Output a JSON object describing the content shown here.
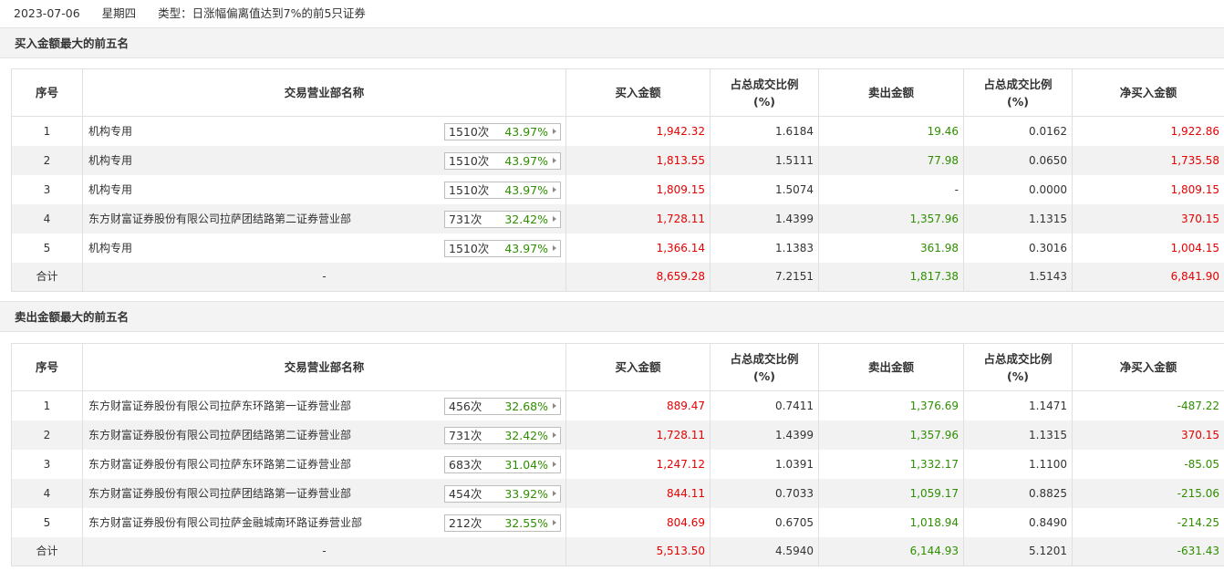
{
  "header": {
    "date": "2023-07-06",
    "weekday": "星期四",
    "type_text": "类型：日涨幅偏离值达到7%的前5只证券"
  },
  "columns": {
    "idx": "序号",
    "name": "交易营业部名称",
    "buy": "买入金额",
    "buy_ratio_line1": "占总成交比例",
    "buy_ratio_line2": "(%)",
    "sell": "卖出金额",
    "sell_ratio_line1": "占总成交比例",
    "sell_ratio_line2": "(%)",
    "net": "净买入金额"
  },
  "buy_section": {
    "title": "买入金额最大的前五名",
    "rows": [
      {
        "idx": "1",
        "name": "机构专用",
        "count": "1510次",
        "pct": "43.97%",
        "buy": "1,942.32",
        "buy_ratio": "1.6184",
        "sell": "19.46",
        "sell_ratio": "0.0162",
        "net": "1,922.86"
      },
      {
        "idx": "2",
        "name": "机构专用",
        "count": "1510次",
        "pct": "43.97%",
        "buy": "1,813.55",
        "buy_ratio": "1.5111",
        "sell": "77.98",
        "sell_ratio": "0.0650",
        "net": "1,735.58"
      },
      {
        "idx": "3",
        "name": "机构专用",
        "count": "1510次",
        "pct": "43.97%",
        "buy": "1,809.15",
        "buy_ratio": "1.5074",
        "sell": "-",
        "sell_ratio": "0.0000",
        "net": "1,809.15"
      },
      {
        "idx": "4",
        "name": "东方财富证券股份有限公司拉萨团结路第二证券营业部",
        "count": "731次",
        "pct": "32.42%",
        "buy": "1,728.11",
        "buy_ratio": "1.4399",
        "sell": "1,357.96",
        "sell_ratio": "1.1315",
        "net": "370.15"
      },
      {
        "idx": "5",
        "name": "机构专用",
        "count": "1510次",
        "pct": "43.97%",
        "buy": "1,366.14",
        "buy_ratio": "1.1383",
        "sell": "361.98",
        "sell_ratio": "0.3016",
        "net": "1,004.15"
      }
    ],
    "total": {
      "label": "合计",
      "name": "-",
      "buy": "8,659.28",
      "buy_ratio": "7.2151",
      "sell": "1,817.38",
      "sell_ratio": "1.5143",
      "net": "6,841.90"
    }
  },
  "sell_section": {
    "title": "卖出金额最大的前五名",
    "rows": [
      {
        "idx": "1",
        "name": "东方财富证券股份有限公司拉萨东环路第一证券营业部",
        "count": "456次",
        "pct": "32.68%",
        "buy": "889.47",
        "buy_ratio": "0.7411",
        "sell": "1,376.69",
        "sell_ratio": "1.1471",
        "net": "-487.22"
      },
      {
        "idx": "2",
        "name": "东方财富证券股份有限公司拉萨团结路第二证券营业部",
        "count": "731次",
        "pct": "32.42%",
        "buy": "1,728.11",
        "buy_ratio": "1.4399",
        "sell": "1,357.96",
        "sell_ratio": "1.1315",
        "net": "370.15"
      },
      {
        "idx": "3",
        "name": "东方财富证券股份有限公司拉萨东环路第二证券营业部",
        "count": "683次",
        "pct": "31.04%",
        "buy": "1,247.12",
        "buy_ratio": "1.0391",
        "sell": "1,332.17",
        "sell_ratio": "1.1100",
        "net": "-85.05"
      },
      {
        "idx": "4",
        "name": "东方财富证券股份有限公司拉萨团结路第一证券营业部",
        "count": "454次",
        "pct": "33.92%",
        "buy": "844.11",
        "buy_ratio": "0.7033",
        "sell": "1,059.17",
        "sell_ratio": "0.8825",
        "net": "-215.06"
      },
      {
        "idx": "5",
        "name": "东方财富证券股份有限公司拉萨金融城南环路证券营业部",
        "count": "212次",
        "pct": "32.55%",
        "buy": "804.69",
        "buy_ratio": "0.6705",
        "sell": "1,018.94",
        "sell_ratio": "0.8490",
        "net": "-214.25"
      }
    ],
    "total": {
      "label": "合计",
      "name": "-",
      "buy": "5,513.50",
      "buy_ratio": "4.5940",
      "sell": "6,144.93",
      "sell_ratio": "5.1201",
      "net": "-631.43"
    }
  },
  "colors": {
    "positive": "#e60000",
    "negative": "#2f8f00",
    "badge_pct": "#2f8f00"
  },
  "icons": {
    "badge_arrow": "caret-right-icon"
  }
}
